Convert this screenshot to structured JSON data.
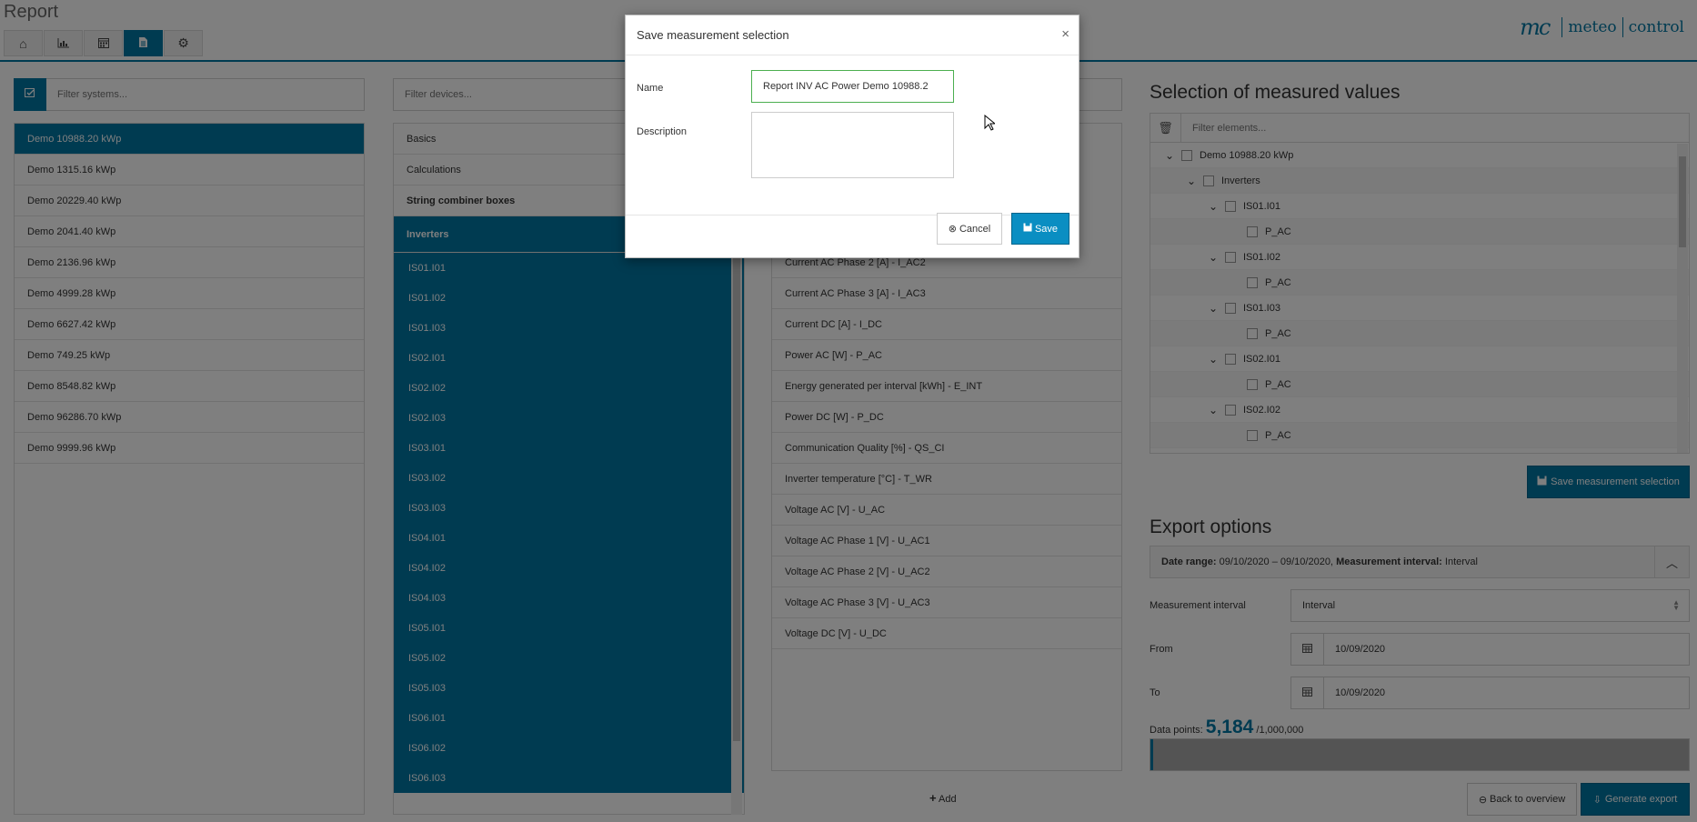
{
  "header": {
    "title": "Report",
    "nav_icons": [
      "home-icon",
      "chart-icon",
      "calendar-icon",
      "report-icon",
      "gear-icon"
    ],
    "active_tab": 3,
    "brand_mark": "mc",
    "brand_word1": "meteo",
    "brand_word2": "control"
  },
  "systems": {
    "filter_placeholder": "Filter systems...",
    "items": [
      "Demo 10988.20 kWp",
      "Demo 1315.16 kWp",
      "Demo 20229.40 kWp",
      "Demo 2041.40 kWp",
      "Demo 2136.96 kWp",
      "Demo 4999.28 kWp",
      "Demo 6627.42 kWp",
      "Demo 749.25 kWp",
      "Demo 8548.82 kWp",
      "Demo 96286.70 kWp",
      "Demo 9999.96 kWp"
    ]
  },
  "devices": {
    "filter_placeholder": "Filter devices...",
    "categories": [
      "Basics",
      "Calculations",
      "String combiner boxes",
      "Inverters"
    ],
    "inverters": [
      "IS01.I01",
      "IS01.I02",
      "IS01.I03",
      "IS02.I01",
      "IS02.I02",
      "IS02.I03",
      "IS03.I01",
      "IS03.I02",
      "IS03.I03",
      "IS04.I01",
      "IS04.I02",
      "IS04.I03",
      "IS05.I01",
      "IS05.I02",
      "IS05.I03",
      "IS06.I01",
      "IS06.I02",
      "IS06.I03"
    ]
  },
  "measurements": {
    "items": [
      "Current AC Phase 2 [A] - I_AC2",
      "Current AC Phase 3 [A] - I_AC3",
      "Current DC [A] - I_DC",
      "Power AC [W] - P_AC",
      "Energy generated per interval [kWh] - E_INT",
      "Power DC [W] - P_DC",
      "Communication Quality [%] - QS_CI",
      "Inverter temperature [°C] - T_WR",
      "Voltage AC [V] - U_AC",
      "Voltage AC Phase 1 [V] - U_AC1",
      "Voltage AC Phase 2 [V] - U_AC2",
      "Voltage AC Phase 3 [V] - U_AC3",
      "Voltage DC [V] - U_DC"
    ],
    "add_label": "Add"
  },
  "selection": {
    "title": "Selection of measured values",
    "filter_placeholder": "Filter elements...",
    "tree": [
      {
        "label": "Demo 10988.20 kWp",
        "level": 0,
        "chevron": true
      },
      {
        "label": "Inverters",
        "level": 1,
        "chevron": true
      },
      {
        "label": "IS01.I01",
        "level": 2,
        "chevron": true
      },
      {
        "label": "P_AC",
        "level": 3,
        "chevron": false
      },
      {
        "label": "IS01.I02",
        "level": 2,
        "chevron": true
      },
      {
        "label": "P_AC",
        "level": 3,
        "chevron": false
      },
      {
        "label": "IS01.I03",
        "level": 2,
        "chevron": true
      },
      {
        "label": "P_AC",
        "level": 3,
        "chevron": false
      },
      {
        "label": "IS02.I01",
        "level": 2,
        "chevron": true
      },
      {
        "label": "P_AC",
        "level": 3,
        "chevron": false
      },
      {
        "label": "IS02.I02",
        "level": 2,
        "chevron": true
      },
      {
        "label": "P_AC",
        "level": 3,
        "chevron": false
      }
    ],
    "save_button": "Save measurement selection"
  },
  "export": {
    "title": "Export options",
    "date_range_label": "Date range:",
    "date_range_value": "09/10/2020 – 09/10/2020,",
    "interval_label": "Measurement interval:",
    "interval_value": "Interval",
    "measurement_interval_label": "Measurement interval",
    "measurement_interval_value": "Interval",
    "from_label": "From",
    "from_value": "10/09/2020",
    "to_label": "To",
    "to_value": "10/09/2020",
    "data_points_label": "Data points:",
    "data_points_value": "5,184",
    "data_points_total": "/1,000,000",
    "data_points_fraction": 0.005184,
    "back_button": "Back to overview",
    "generate_button": "Generate export"
  },
  "modal": {
    "title": "Save measurement selection",
    "close": "×",
    "name_label": "Name",
    "name_value": "Report INV AC Power Demo 10988.2",
    "description_label": "Description",
    "cancel_label": "Cancel",
    "save_label": "Save"
  },
  "colors": {
    "accent": "#0076a3",
    "accent_dark": "#005a7d",
    "overlay": "rgba(0,0,0,0.5)"
  }
}
